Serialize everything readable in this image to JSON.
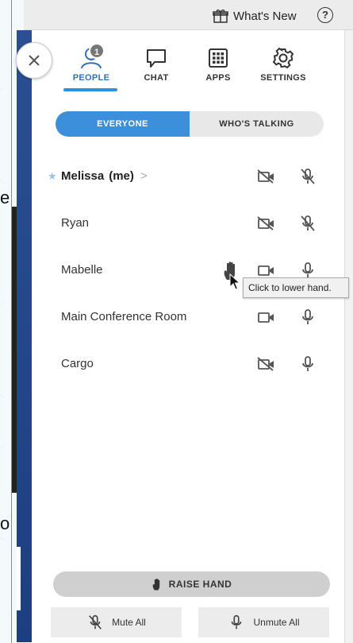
{
  "background": {
    "edge_chars": [
      "e",
      "o"
    ]
  },
  "topbar": {
    "whats_new_label": "What's New",
    "help_glyph": "?"
  },
  "close_button": {
    "icon": "close-icon"
  },
  "tabs": [
    {
      "label": "PEOPLE",
      "icon": "people-icon",
      "active": true,
      "badge": "1"
    },
    {
      "label": "CHAT",
      "icon": "chat-icon",
      "active": false
    },
    {
      "label": "APPS",
      "icon": "apps-grid-icon",
      "active": false
    },
    {
      "label": "SETTINGS",
      "icon": "gear-icon",
      "active": false
    }
  ],
  "filter": {
    "everyone": "EVERYONE",
    "whos_talking": "WHO'S TALKING",
    "selected": "EVERYONE"
  },
  "participants": [
    {
      "name": "Melissa",
      "suffix": "(me)",
      "chevron": ">",
      "starred": true,
      "video": "off",
      "mic": "off",
      "hand_raised": false
    },
    {
      "name": "Ryan",
      "video": "off",
      "mic": "off",
      "hand_raised": false
    },
    {
      "name": "Mabelle",
      "video": "on",
      "mic": "on",
      "hand_raised": true
    },
    {
      "name": "Main Conference Room",
      "video": "on",
      "mic": "on",
      "hand_raised": false
    },
    {
      "name": "Cargo",
      "video": "off",
      "mic": "on",
      "hand_raised": false
    }
  ],
  "tooltip": {
    "text": "Click to lower hand."
  },
  "footer": {
    "raise_hand": "RAISE HAND",
    "mute_all": "Mute All",
    "unmute_all": "Unmute All"
  },
  "colors": {
    "accent": "#3b8fdb",
    "sidebar": "#1c3f82",
    "icon": "#555555"
  }
}
